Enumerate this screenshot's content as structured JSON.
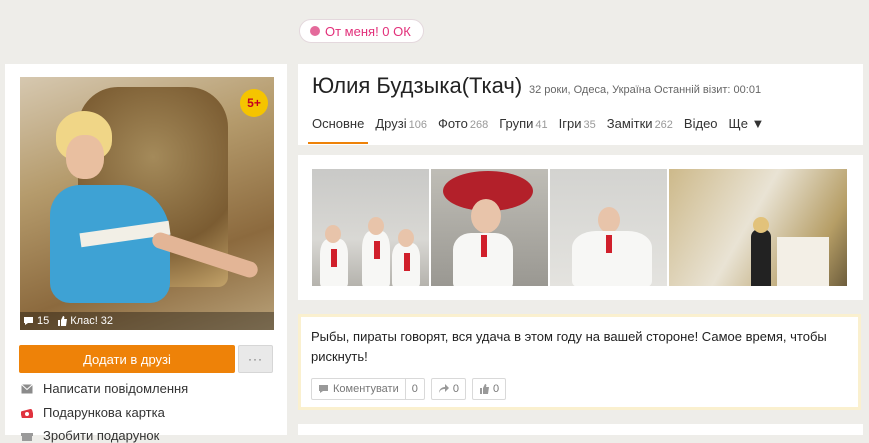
{
  "gift_pill": {
    "icon": "gift-icon",
    "label": "От меня! 0 ОК"
  },
  "profile": {
    "name": "Юлия Будзыка(Ткач)",
    "meta": "32 роки, Одеса, Україна  Останній візит: 00:01",
    "age_badge": "5+",
    "stats": {
      "comments": "15",
      "likes_label": "Клас! 32"
    }
  },
  "nav": [
    {
      "label": "Основне",
      "count": ""
    },
    {
      "label": "Друзі",
      "count": "106"
    },
    {
      "label": "Фото",
      "count": "268"
    },
    {
      "label": "Групи",
      "count": "41"
    },
    {
      "label": "Ігри",
      "count": "35"
    },
    {
      "label": "Замітки",
      "count": "262"
    },
    {
      "label": "Відео",
      "count": ""
    },
    {
      "label": "Ще ▼",
      "count": ""
    }
  ],
  "actions": {
    "add_friend": "Додати в друзі",
    "more": "···",
    "send_message": "Написати повідомлення",
    "gift_card": "Подарункова картка",
    "make_gift": "Зробити подарунок"
  },
  "status": {
    "text": "Рыбы, пираты говорят, вся удача в этом году на вашей стороне! Самое время, чтобы рискнуть!",
    "comment_label": "Коментувати",
    "comment_count": "0",
    "share_count": "0",
    "like_count": "0"
  },
  "colors": {
    "accent": "#ee8208",
    "pink": "#e2307a",
    "badge": "#f5c400"
  }
}
